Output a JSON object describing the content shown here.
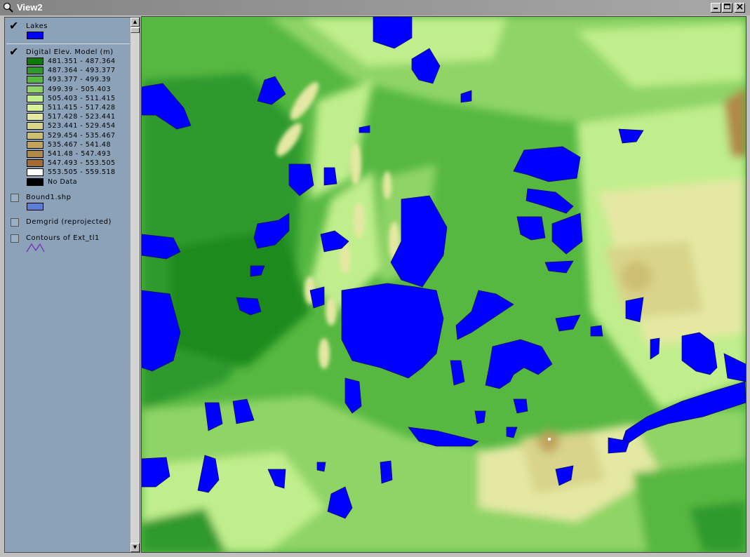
{
  "window": {
    "title": "View2"
  },
  "toc": {
    "layers": [
      {
        "name": "Lakes",
        "checked": true,
        "swatch": "#0000ff"
      },
      {
        "name": "Digital Elev. Model (m)",
        "checked": true
      },
      {
        "name": "Bound1.shp",
        "checked": false,
        "swatch": "#5b7fd6"
      },
      {
        "name": "Demgrid (reprojected)",
        "checked": false
      },
      {
        "name": "Contours of Ext_tl1",
        "checked": false,
        "swatch_color": "#7a2fbf"
      }
    ],
    "dem_classes": [
      {
        "label": "481.351 - 487.364",
        "color": "#0b7a0b"
      },
      {
        "label": "487.364 - 493.377",
        "color": "#2e9a2e"
      },
      {
        "label": "493.377 - 499.39",
        "color": "#56b841"
      },
      {
        "label": "499.39 - 505.403",
        "color": "#8fd466"
      },
      {
        "label": "505.403 - 511.415",
        "color": "#c0ee8c"
      },
      {
        "label": "511.415 - 517.428",
        "color": "#d7f29a"
      },
      {
        "label": "517.428 - 523.441",
        "color": "#e4e8a2"
      },
      {
        "label": "523.441 - 529.454",
        "color": "#d8d48a"
      },
      {
        "label": "529.454 - 535.467",
        "color": "#ccbf72"
      },
      {
        "label": "535.467 - 541.48",
        "color": "#c0a45c"
      },
      {
        "label": "541.48 - 547.493",
        "color": "#b08848"
      },
      {
        "label": "547.493 - 553.505",
        "color": "#a56b35"
      },
      {
        "label": "553.505 - 559.518",
        "color": "#ffffff"
      },
      {
        "label": "No Data",
        "color": "#000000"
      }
    ]
  },
  "map": {
    "lake_color": "#0000ff",
    "base_color": "#56b841"
  }
}
